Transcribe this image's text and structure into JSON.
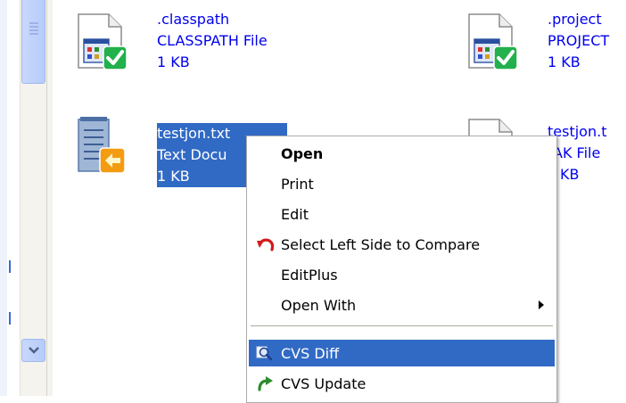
{
  "files": [
    {
      "id": "classpath",
      "name": ".classpath",
      "type": "CLASSPATH File",
      "size": "1 KB",
      "icon": "java-settings-cvs-ok-icon"
    },
    {
      "id": "project",
      "name": ".project",
      "type": "PROJECT",
      "size": "1 KB",
      "icon": "java-settings-cvs-ok-icon"
    },
    {
      "id": "testjon-txt",
      "name": "testjon.txt",
      "type": "Text Docu",
      "size": "1 KB",
      "icon": "notepad-cvs-modified-icon"
    },
    {
      "id": "testjon-bak",
      "name": "testjon.t",
      "type": "AK File",
      "size": "KB",
      "icon": "generic-file-icon"
    }
  ],
  "context_menu": {
    "items": [
      {
        "label": "Open",
        "bold": true
      },
      {
        "label": "Print"
      },
      {
        "label": "Edit"
      },
      {
        "label": "Select Left Side to Compare",
        "icon": "undo-arrow-icon"
      },
      {
        "label": "EditPlus"
      },
      {
        "label": "Open With",
        "submenu": true
      },
      {
        "label": "CVS Diff",
        "icon": "magnifier-icon",
        "highlighted": true
      },
      {
        "label": "CVS Update",
        "icon": "cvs-update-icon"
      }
    ]
  },
  "colors": {
    "selection": "#316ac5",
    "link": "#0000ee",
    "cvs_ok": "#22b14c",
    "cvs_modified": "#f39c12"
  }
}
